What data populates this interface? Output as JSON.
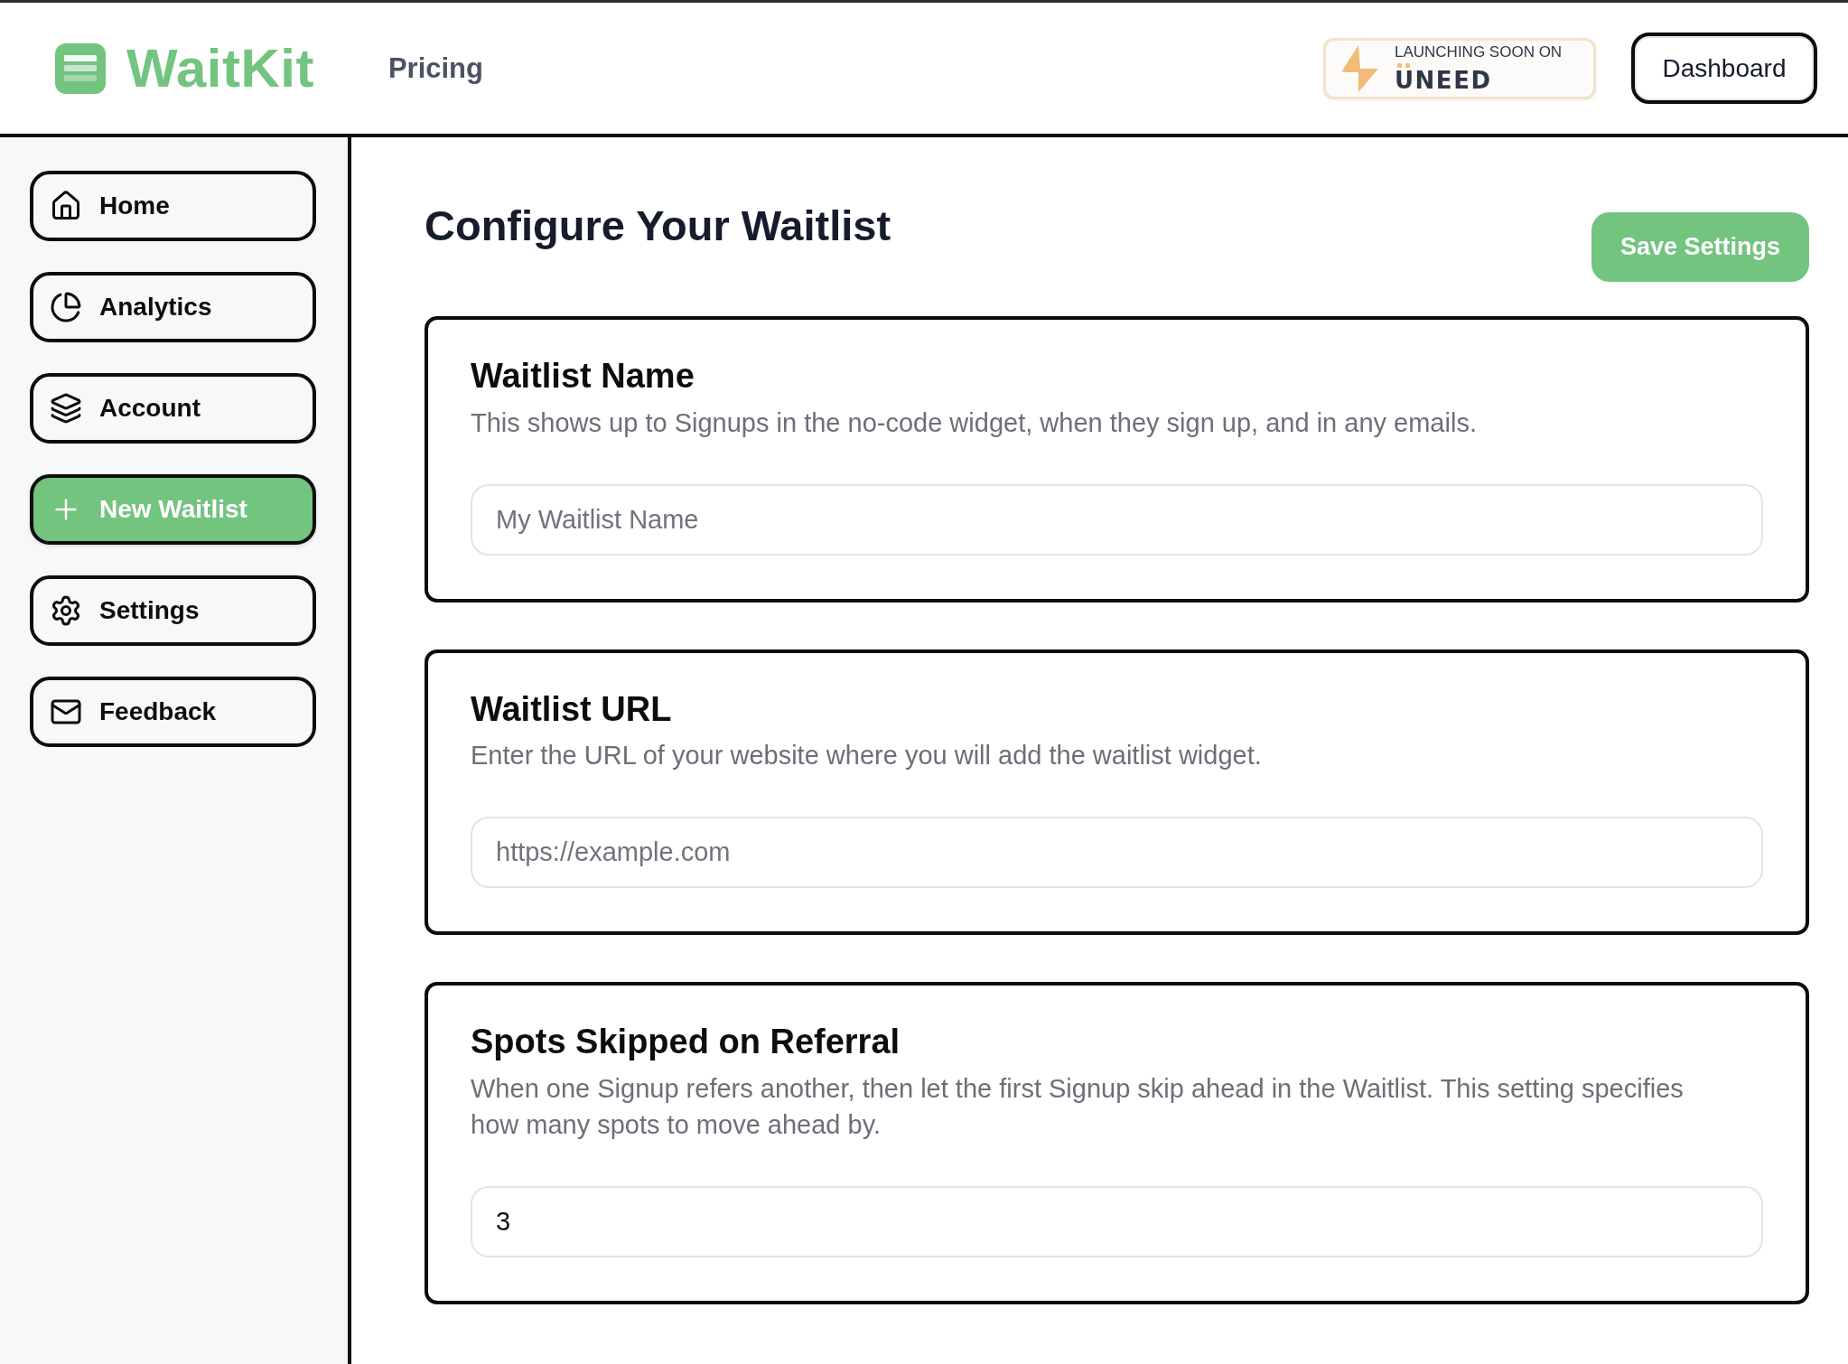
{
  "header": {
    "logo": "WaitKit",
    "nav": [
      {
        "label": "Pricing"
      }
    ],
    "badge": {
      "caption": "LAUNCHING SOON ON",
      "brand": "UNEED"
    },
    "button": "Dashboard"
  },
  "sidebar": {
    "items": [
      {
        "label": "Home",
        "selected": false
      },
      {
        "label": "Analytics",
        "selected": false
      },
      {
        "label": "Account",
        "selected": false
      },
      {
        "label": "New Waitlist",
        "selected": true
      },
      {
        "label": "Settings",
        "selected": false
      },
      {
        "label": "Feedback",
        "selected": false
      }
    ]
  },
  "main": {
    "title": "Configure Your Waitlist",
    "save_button": "Save Settings",
    "sections": [
      {
        "title": "Waitlist Name",
        "description": "This shows up to Signups in the no-code widget, when they sign up, and in any emails.",
        "field": {
          "placeholder": "My Waitlist Name"
        }
      },
      {
        "title": "Waitlist URL",
        "description": "Enter the URL of your website where you will add the waitlist widget.",
        "field": {
          "placeholder": "https://example.com"
        }
      },
      {
        "title": "Spots Skipped on Referral",
        "description": "When one Signup refers another, then let the first Signup skip ahead in the Waitlist. This setting specifies how many spots to move ahead by.",
        "field": {
          "value": "3"
        }
      }
    ]
  }
}
